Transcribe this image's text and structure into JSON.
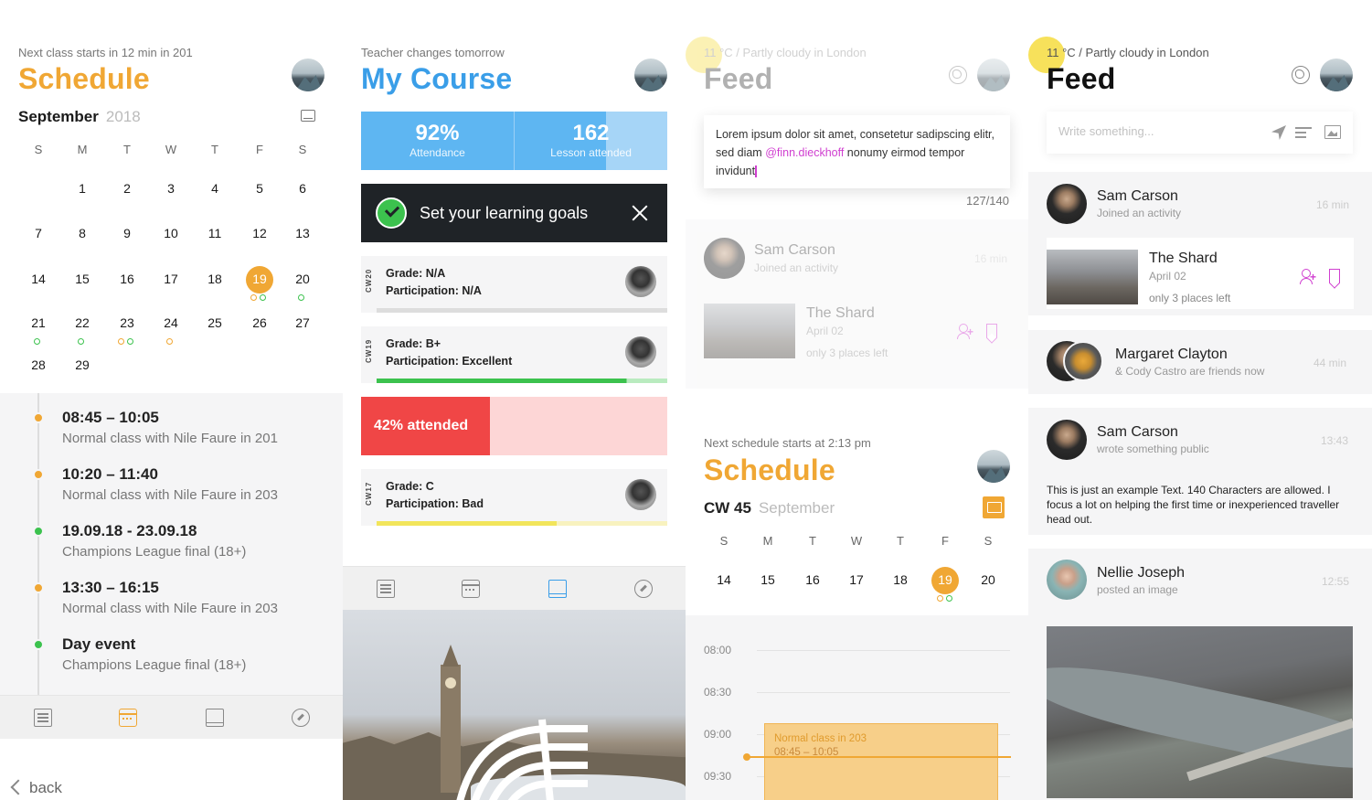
{
  "panel1": {
    "subtitle": "Next class starts in 12 min in 201",
    "title": "Schedule",
    "title_color": "#f0a734",
    "month": "September",
    "year": "2018",
    "weekdays": [
      "S",
      "M",
      "T",
      "W",
      "T",
      "F",
      "S"
    ],
    "days": [
      "1",
      "2",
      "3",
      "4",
      "5",
      "6",
      "7",
      "8",
      "9",
      "10",
      "11",
      "12",
      "13",
      "14",
      "15",
      "16",
      "17",
      "18",
      "19",
      "20",
      "21",
      "22",
      "23",
      "24",
      "25",
      "26",
      "27",
      "28",
      "29"
    ],
    "selected_day": "19",
    "agenda": [
      {
        "time": "08:45 – 10:05",
        "desc": "Normal class with Nile Faure in 201",
        "status": "orange"
      },
      {
        "time": "10:20 – 11:40",
        "desc": "Normal class with Nile Faure in 203",
        "status": "orange"
      },
      {
        "time": "19.09.18 - 23.09.18",
        "desc": "Champions League final (18+)",
        "status": "green"
      },
      {
        "time": "13:30 – 16:15",
        "desc": "Normal class with Nile Faure in 203",
        "status": "orange"
      },
      {
        "time": "Day event",
        "desc": "Champions League final (18+)",
        "status": "green"
      }
    ],
    "back_label": "back"
  },
  "panel2": {
    "subtitle": "Teacher changes tomorrow",
    "title": "My Course",
    "title_color": "#3a9ee8",
    "stats": [
      {
        "value": "92%",
        "label": "Attendance"
      },
      {
        "value": "162",
        "label": "Lesson attended"
      }
    ],
    "goals_label": "Set your learning goals",
    "grades": [
      {
        "cw": "CW20",
        "grade": "Grade: N/A",
        "participation": "Participation: N/A",
        "progress": 0,
        "color": "#cccccc"
      },
      {
        "cw": "CW19",
        "grade": "Grade: B+",
        "participation": "Participation: Excellent",
        "progress": 0.86,
        "color": "#3cc24e"
      },
      {
        "cw": "CW17",
        "grade": "Grade: C",
        "participation": "Participation: Bad",
        "progress": 0.62,
        "color": "#f2e55b"
      }
    ],
    "attended_label": "42% attended",
    "attended_fraction": 0.42
  },
  "panel3": {
    "weather": "11 °C / Partly cloudy in London",
    "title": "Feed",
    "compose_text_1": "Lorem ipsum dolor sit amet, consetetur sadipscing elitr, sed diam ",
    "compose_mention": "@finn.dieckhoff",
    "compose_text_2": " nonumy eirmod tempor invidunt",
    "counter": "127/140",
    "feed": {
      "name": "Sam Carson",
      "sub": "Joined an activity",
      "time": "16 min",
      "event_title": "The Shard",
      "event_date": "April 02",
      "event_places": "only 3 places left"
    },
    "schedule_subtitle": "Next schedule starts at 2:13 pm",
    "schedule_title": "Schedule",
    "cw": "CW 45",
    "month": "September",
    "weekdays": [
      "S",
      "M",
      "T",
      "W",
      "T",
      "F",
      "S"
    ],
    "week_days": [
      "14",
      "15",
      "16",
      "17",
      "18",
      "19",
      "20"
    ],
    "selected_day": "19",
    "times": [
      "08:00",
      "08:30",
      "09:00",
      "09:30"
    ],
    "event_title": "Normal class in 203",
    "event_time": "08:45 – 10:05"
  },
  "panel4": {
    "weather": "11 °C / Partly cloudy in London",
    "title": "Feed",
    "write_placeholder": "Write something...",
    "items": [
      {
        "name": "Sam Carson",
        "sub": "Joined an activity",
        "time": "16 min"
      },
      {
        "name": "Margaret Clayton",
        "sub": "& Cody Castro are friends now",
        "time": "44 min"
      },
      {
        "name": "Sam Carson",
        "sub": "wrote something public",
        "time": "13:43"
      },
      {
        "name": "Nellie Joseph",
        "sub": "posted an image",
        "time": "12:55"
      }
    ],
    "event_title": "The Shard",
    "event_date": "April 02",
    "event_places": "only 3 places left",
    "post_text": "This is just an example Text. 140 Characters are allowed. I focus a lot on helping the first time or inexperienced traveller head out."
  }
}
